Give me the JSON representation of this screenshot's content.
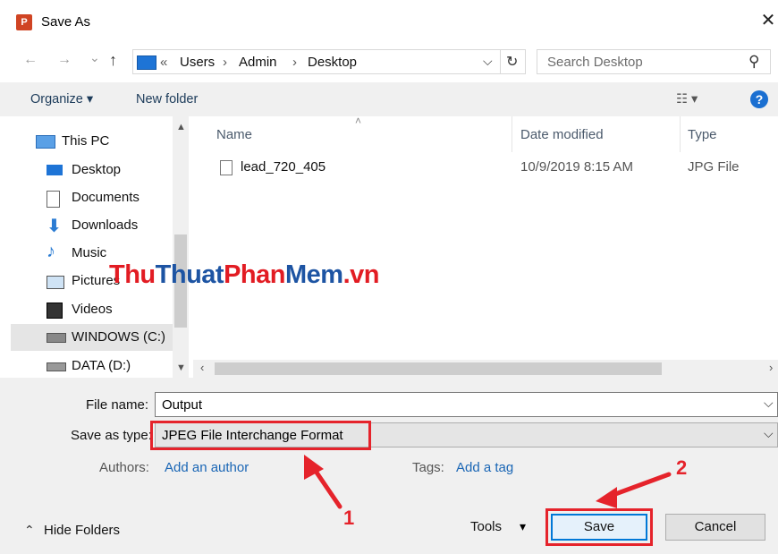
{
  "window": {
    "title": "Save As",
    "close_glyph": "✕",
    "app_icon_letter": "P"
  },
  "address": {
    "prefix": "«",
    "crumbs": [
      "Users",
      "Admin",
      "Desktop"
    ],
    "separator": "›",
    "dropdown_glyph": "⌵",
    "refresh_glyph": "↻"
  },
  "nav": {
    "back": "←",
    "forward": "→",
    "recent": "⌄",
    "up": "↑"
  },
  "search": {
    "placeholder": "Search Desktop",
    "icon_glyph": "⚲"
  },
  "toolbar": {
    "organize": "Organize ▾",
    "new_folder": "New folder",
    "view_glyph": "☷ ▾",
    "help_glyph": "?"
  },
  "sidebar": {
    "items": [
      {
        "label": "This PC",
        "icon": "computer-icon"
      },
      {
        "label": "Desktop",
        "icon": "desktop-icon"
      },
      {
        "label": "Documents",
        "icon": "documents-icon"
      },
      {
        "label": "Downloads",
        "icon": "downloads-icon"
      },
      {
        "label": "Music",
        "icon": "music-icon"
      },
      {
        "label": "Pictures",
        "icon": "pictures-icon"
      },
      {
        "label": "Videos",
        "icon": "videos-icon"
      },
      {
        "label": "WINDOWS (C:)",
        "icon": "drive-icon",
        "selected": true
      },
      {
        "label": "DATA (D:)",
        "icon": "drive-icon"
      }
    ]
  },
  "file_list": {
    "columns": [
      "Name",
      "Date modified",
      "Type"
    ],
    "rows": [
      {
        "name": "lead_720_405",
        "date": "10/9/2019 8:15 AM",
        "type": "JPG File"
      }
    ]
  },
  "form": {
    "file_name_label": "File name:",
    "file_name_value": "Output",
    "save_type_label": "Save as type:",
    "save_type_value": "JPEG File Interchange Format",
    "authors_label": "Authors:",
    "authors_link": "Add an author",
    "tags_label": "Tags:",
    "tags_link": "Add a tag"
  },
  "footer": {
    "hide_folders": "Hide Folders",
    "hide_glyph": "⌃",
    "tools": "Tools",
    "tools_glyph": "▾",
    "save": "Save",
    "cancel": "Cancel"
  },
  "annotations": {
    "callout_1": "1",
    "callout_2": "2"
  },
  "watermark": {
    "part_red_1": "Thu",
    "part_blue_1": "Thuat",
    "part_red_2": "Phan",
    "part_blue_2": "Mem",
    "part_red_3": ".vn"
  },
  "colors": {
    "accent": "#0078d7",
    "annotation_red": "#e5232b",
    "link": "#1a66b5"
  }
}
